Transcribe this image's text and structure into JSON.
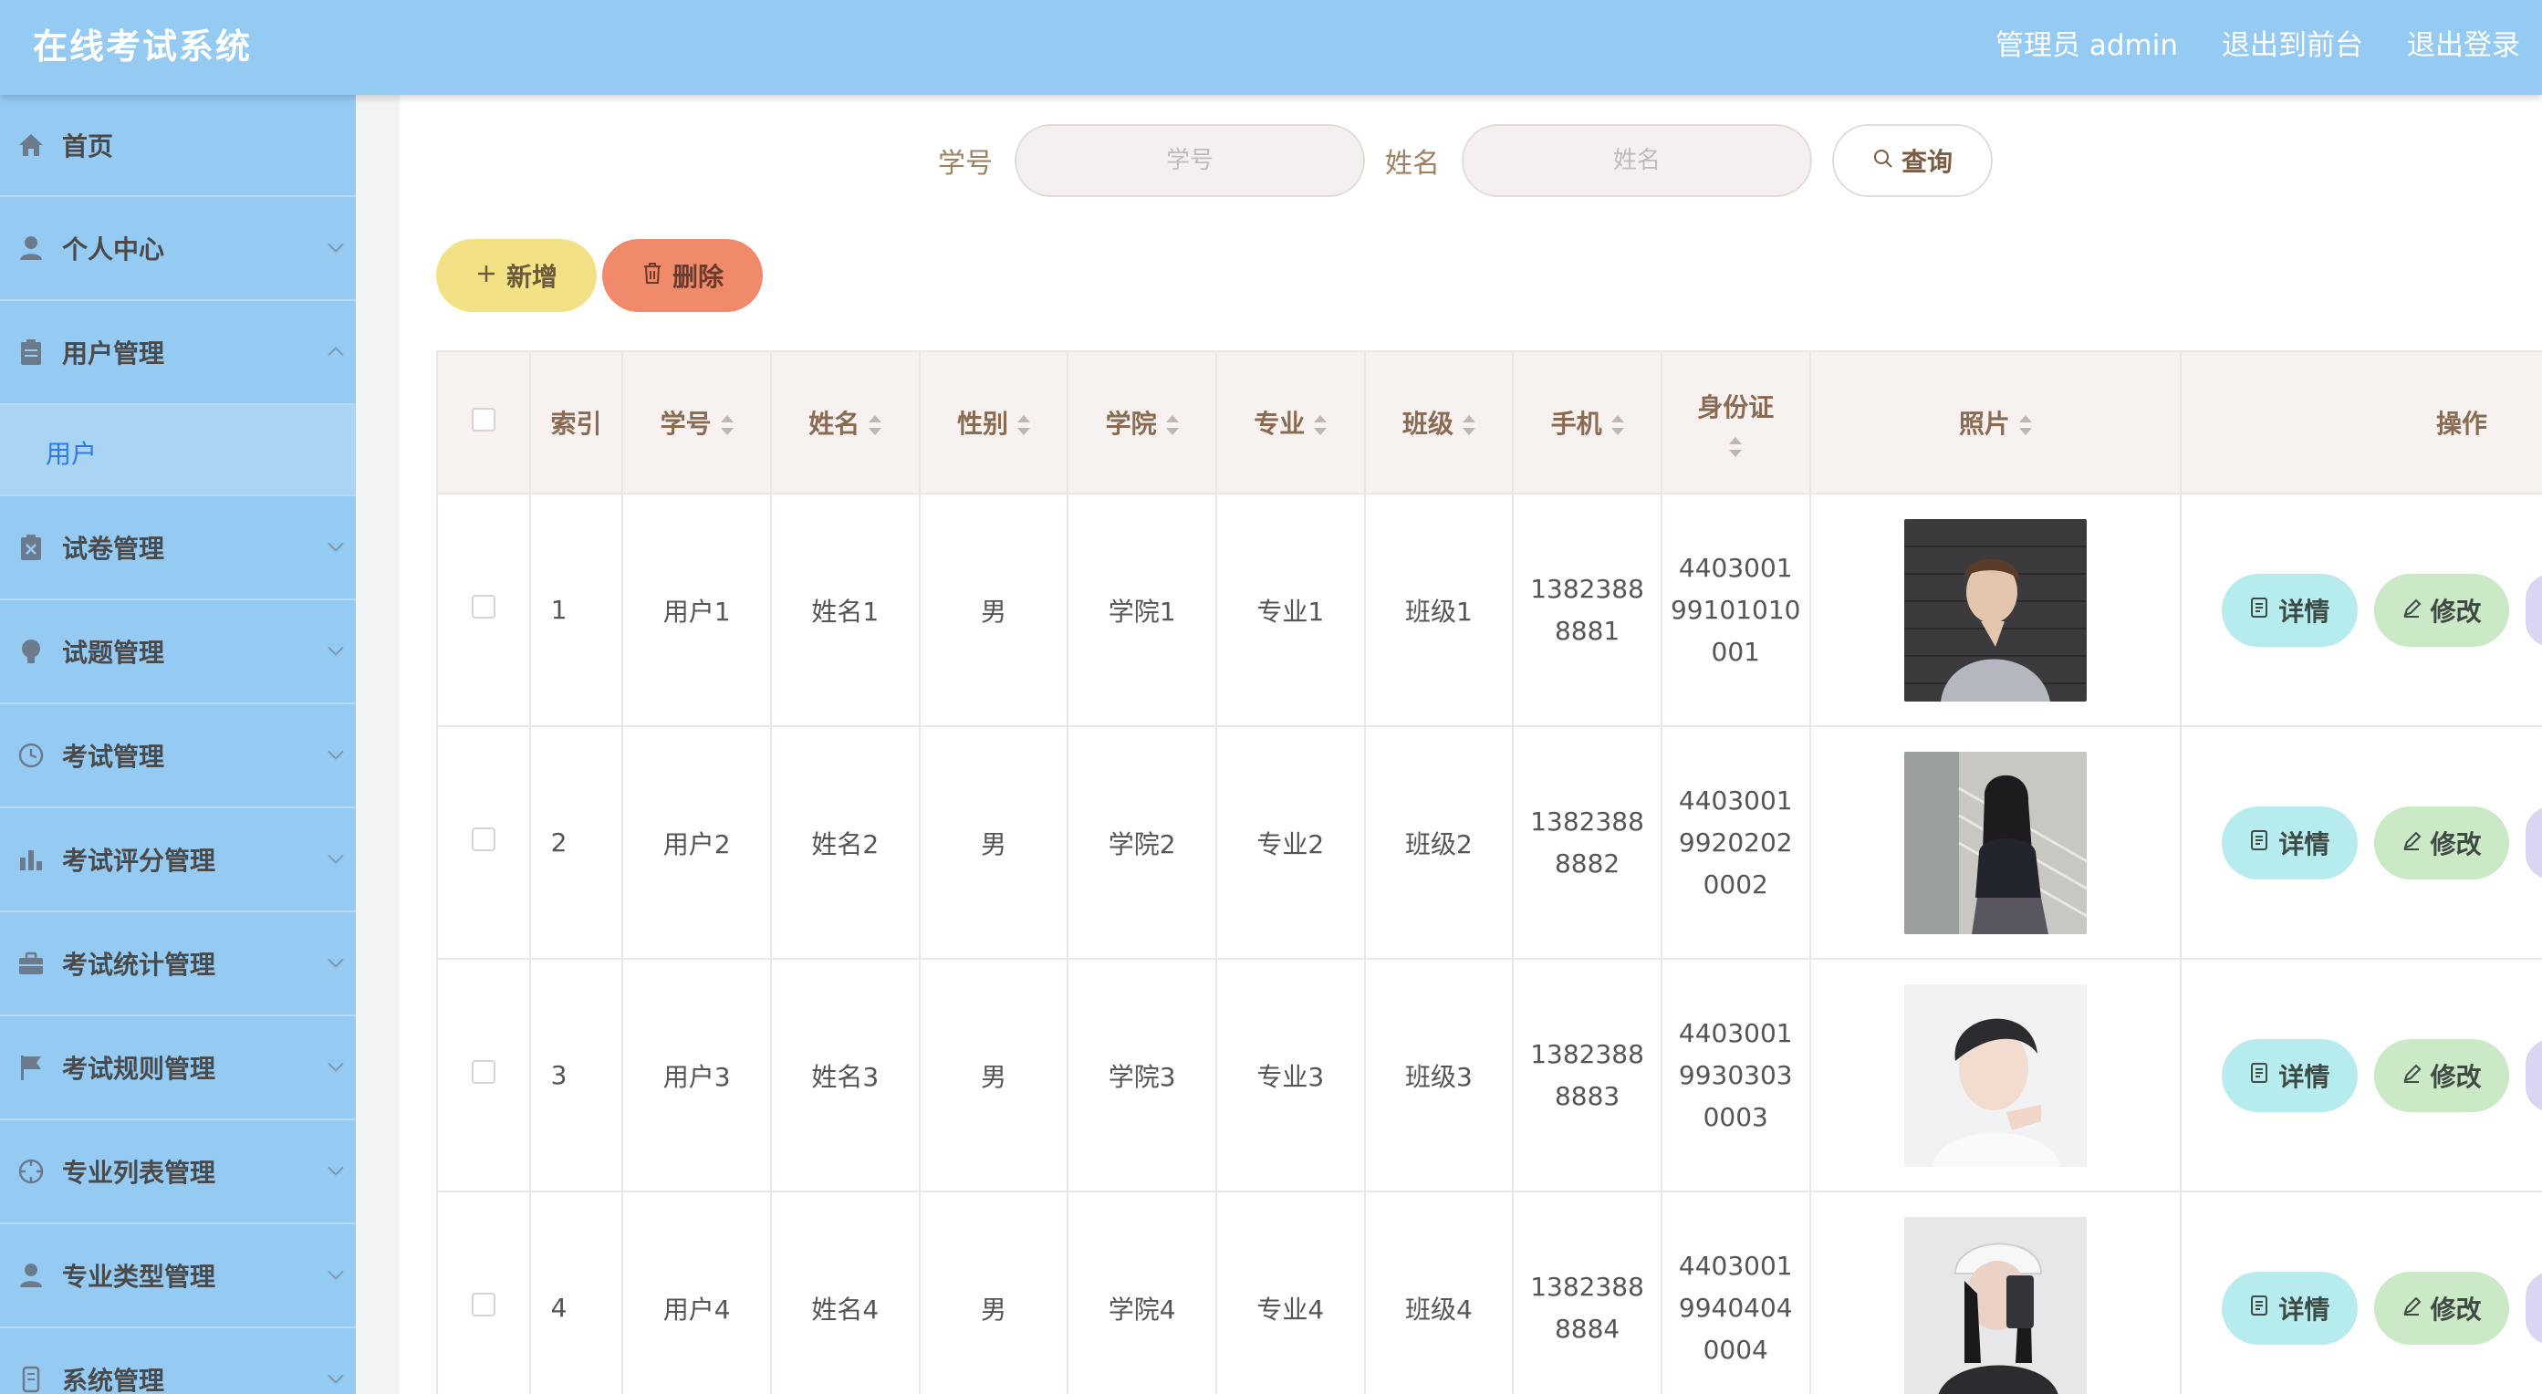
{
  "header": {
    "title": "在线考试系统",
    "user": "管理员 admin",
    "to_front": "退出到前台",
    "logout": "退出登录"
  },
  "sidebar": {
    "items": [
      {
        "label": "首页",
        "icon": "home-icon"
      },
      {
        "label": "个人中心",
        "icon": "user-icon"
      },
      {
        "label": "用户管理",
        "icon": "clipboard-icon",
        "expanded": true,
        "children": [
          {
            "label": "用户",
            "active": true
          }
        ]
      },
      {
        "label": "试卷管理",
        "icon": "paper-icon"
      },
      {
        "label": "试题管理",
        "icon": "bulb-icon"
      },
      {
        "label": "考试管理",
        "icon": "clock-icon"
      },
      {
        "label": "考试评分管理",
        "icon": "bar-chart-icon"
      },
      {
        "label": "考试统计管理",
        "icon": "briefcase-icon"
      },
      {
        "label": "考试规则管理",
        "icon": "flag-icon"
      },
      {
        "label": "专业列表管理",
        "icon": "compass-icon"
      },
      {
        "label": "专业类型管理",
        "icon": "user-icon"
      },
      {
        "label": "系统管理",
        "icon": "device-icon"
      }
    ]
  },
  "search": {
    "student_no_label": "学号",
    "student_no_placeholder": "学号",
    "name_label": "姓名",
    "name_placeholder": "姓名",
    "query_button": "查询"
  },
  "actions": {
    "add": "新增",
    "delete": "删除"
  },
  "table": {
    "headers": {
      "index": "索引",
      "student_no": "学号",
      "name": "姓名",
      "gender": "性别",
      "college": "学院",
      "major": "专业",
      "class": "班级",
      "phone": "手机",
      "id_card": "身份证",
      "photo": "照片",
      "ops": "操作"
    },
    "detail_label": "详情",
    "edit_label": "修改",
    "rows": [
      {
        "index": "1",
        "student_no": "用户1",
        "name": "姓名1",
        "gender": "男",
        "college": "学院1",
        "major": "专业1",
        "class": "班级1",
        "phone_l1": "1382388",
        "phone_l2": "8881",
        "id_l1": "4403001",
        "id_l2": "99101010",
        "id_l3": "001"
      },
      {
        "index": "2",
        "student_no": "用户2",
        "name": "姓名2",
        "gender": "男",
        "college": "学院2",
        "major": "专业2",
        "class": "班级2",
        "phone_l1": "1382388",
        "phone_l2": "8882",
        "id_l1": "4403001",
        "id_l2": "9920202",
        "id_l3": "0002"
      },
      {
        "index": "3",
        "student_no": "用户3",
        "name": "姓名3",
        "gender": "男",
        "college": "学院3",
        "major": "专业3",
        "class": "班级3",
        "phone_l1": "1382388",
        "phone_l2": "8883",
        "id_l1": "4403001",
        "id_l2": "9930303",
        "id_l3": "0003"
      },
      {
        "index": "4",
        "student_no": "用户4",
        "name": "姓名4",
        "gender": "男",
        "college": "学院4",
        "major": "专业4",
        "class": "班级4",
        "phone_l1": "1382388",
        "phone_l2": "8884",
        "id_l1": "4403001",
        "id_l2": "9940404",
        "id_l3": "0004"
      }
    ]
  },
  "colors": {
    "header_bg": "#95cbf3",
    "sidebar_bg": "#95cbf3",
    "add_button": "#f3e285",
    "delete_button": "#f08a6b",
    "detail_button": "#b6ecee",
    "edit_button": "#cbe9c6"
  }
}
